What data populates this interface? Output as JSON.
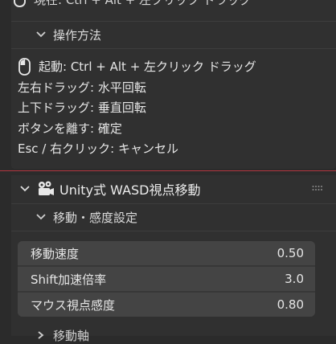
{
  "top_cut_row": {
    "text": "現在: Ctrl + Alt + 左クリック ドラッグ"
  },
  "operation_section": {
    "header": "操作方法",
    "lines": [
      {
        "text": "起動: Ctrl + Alt + 左クリック ドラッグ",
        "icon": "mouse-icon"
      },
      {
        "text": "左右ドラッグ: 水平回転"
      },
      {
        "text": "上下ドラッグ: 垂直回転"
      },
      {
        "text": "ボタンを離す: 確定"
      },
      {
        "text": "Esc / 右クリック: キャンセル"
      }
    ]
  },
  "unity_panel": {
    "title": "Unity式 WASD視点移動",
    "icon": "camera-icon",
    "subsection_header": "移動・感度設定",
    "properties": [
      {
        "label": "移動速度",
        "value": "0.50"
      },
      {
        "label": "Shift加速倍率",
        "value": "3.0"
      },
      {
        "label": "マウス視点感度",
        "value": "0.80"
      }
    ],
    "next_subsection_header": "移動軸"
  },
  "colors": {
    "background": "#2b2b2b",
    "panel": "#303030",
    "field": "#444444",
    "divider": "#b5363f",
    "text": "#e6e6e6"
  }
}
